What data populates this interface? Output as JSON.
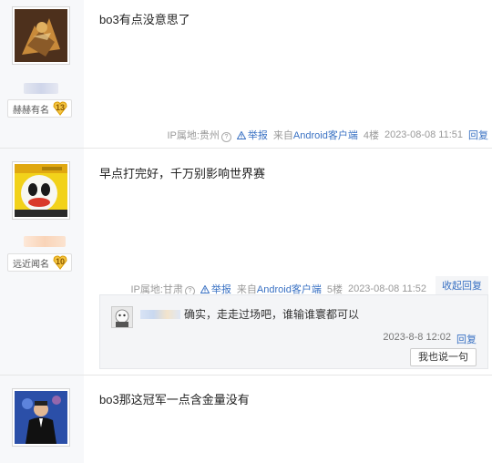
{
  "posts": [
    {
      "badge_text": "赫赫有名",
      "level": "13",
      "content": "bo3有点没意思了",
      "ip_label": "IP属地:贵州",
      "report": "举报",
      "source_prefix": "来自",
      "source": "Android客户端",
      "floor": "4楼",
      "time": "2023-08-08 11:51",
      "reply": "回复"
    },
    {
      "badge_text": "远近闻名",
      "level": "10",
      "content": "早点打完好，千万别影响世界赛",
      "ip_label": "IP属地:甘肃",
      "report": "举报",
      "source_prefix": "来自",
      "source": "Android客户端",
      "floor": "5楼",
      "time": "2023-08-08 11:52",
      "collapse": "收起回复",
      "sub_reply": {
        "text": "确实，走走过场吧，谁输谁寰都可以",
        "time": "2023-8-8 12:02",
        "reply": "回复",
        "say_button": "我也说一句"
      }
    },
    {
      "content": "bo3那这冠军一点含金量没有"
    }
  ],
  "colors": {
    "link": "#3971c3",
    "sidebar_bg": "#f7f8fa",
    "reply_bg": "#f4f5f7"
  },
  "icons": {
    "warn": "warning-triangle-icon",
    "help": "question-circle-icon",
    "level": "heart-badge-icon"
  }
}
